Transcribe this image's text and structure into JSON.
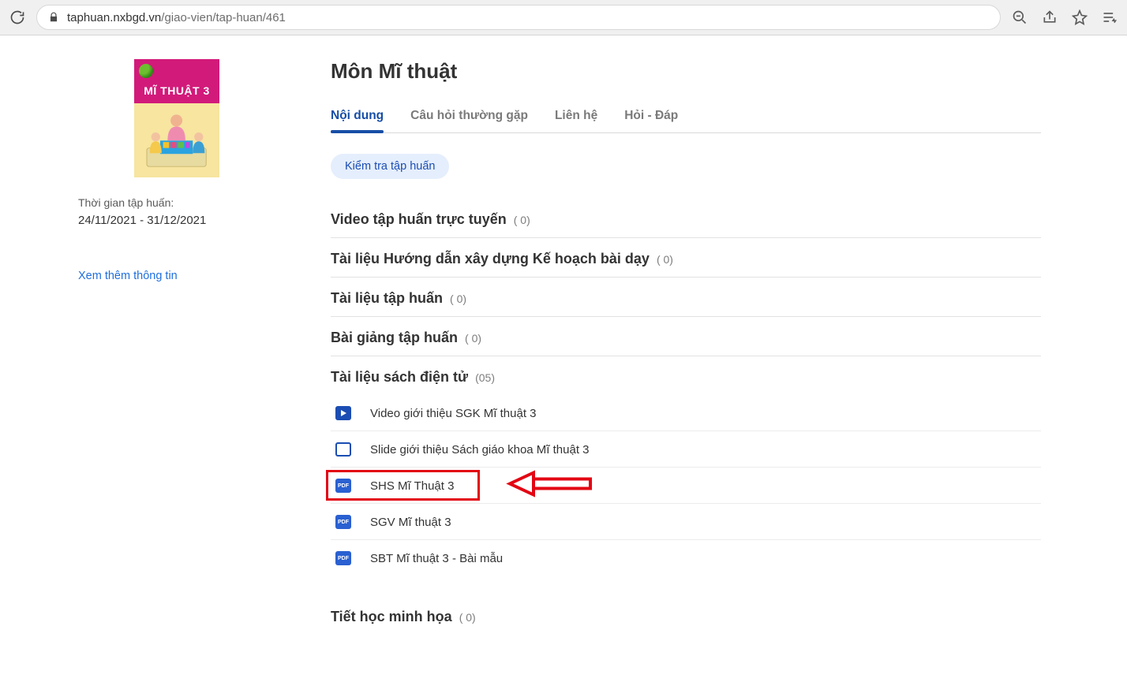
{
  "url": {
    "domain": "taphuan.nxbgd.vn",
    "path": "/giao-vien/tap-huan/461"
  },
  "cover_title": "MĨ THUẬT 3",
  "sidebar": {
    "period_label": "Thời gian tập huấn:",
    "period_value": "24/11/2021 - 31/12/2021",
    "more_link": "Xem thêm thông tin"
  },
  "page_title": "Môn Mĩ thuật",
  "tabs": [
    {
      "key": "content",
      "label": "Nội dung"
    },
    {
      "key": "faq",
      "label": "Câu hỏi thường gặp"
    },
    {
      "key": "contact",
      "label": "Liên hệ"
    },
    {
      "key": "qa",
      "label": "Hỏi - Đáp"
    }
  ],
  "action_badge": "Kiểm tra tập huấn",
  "sections": [
    {
      "key": "video_online",
      "title": "Video tập huấn trực tuyến",
      "count": "( 0)"
    },
    {
      "key": "plan_guide",
      "title": "Tài liệu Hướng dẫn xây dựng Kế hoạch bài dạy",
      "count": "( 0)"
    },
    {
      "key": "train_doc",
      "title": "Tài liệu tập huấn",
      "count": "( 0)"
    },
    {
      "key": "lecture",
      "title": "Bài giảng tập huấn",
      "count": "( 0)"
    },
    {
      "key": "ebook",
      "title": "Tài liệu sách điện tử",
      "count": "(05)"
    },
    {
      "key": "demo",
      "title": "Tiết học minh họa",
      "count": "( 0)"
    }
  ],
  "ebook_items": [
    {
      "icon": "video",
      "label": "Video giới thiệu SGK Mĩ thuật 3"
    },
    {
      "icon": "slide",
      "label": "Slide giới thiệu Sách giáo khoa Mĩ thuật 3"
    },
    {
      "icon": "pdf",
      "label": "SHS Mĩ Thuật 3",
      "highlight": true,
      "pdf_text": "PDF"
    },
    {
      "icon": "pdf",
      "label": "SGV Mĩ thuật 3",
      "pdf_text": "PDF"
    },
    {
      "icon": "pdf",
      "label": "SBT Mĩ thuật 3 - Bài mẫu",
      "pdf_text": "PDF"
    }
  ]
}
